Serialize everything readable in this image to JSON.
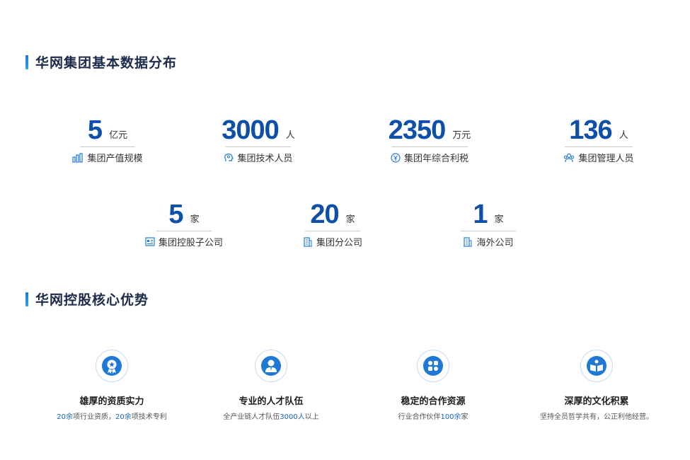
{
  "section1": {
    "title": "华网集团基本数据分布"
  },
  "stats_row1": [
    {
      "value": "5",
      "unit": "亿元",
      "label": "集团产值规模",
      "icon": "building-chart-icon"
    },
    {
      "value": "3000",
      "unit": "人",
      "label": "集团技术人员",
      "icon": "head-brain-icon"
    },
    {
      "value": "2350",
      "unit": "万元",
      "label": "集团年综合利税",
      "icon": "coin-circle-icon"
    },
    {
      "value": "136",
      "unit": "人",
      "label": "集团管理人员",
      "icon": "people-group-icon"
    }
  ],
  "stats_row2": [
    {
      "value": "5",
      "unit": "家",
      "label": "集团控股子公司",
      "icon": "id-card-icon"
    },
    {
      "value": "20",
      "unit": "家",
      "label": "集团分公司",
      "icon": "office-building-icon"
    },
    {
      "value": "1",
      "unit": "家",
      "label": "海外公司",
      "icon": "office-building-icon"
    }
  ],
  "section2": {
    "title": "华网控股核心优势"
  },
  "advantages": [
    {
      "title": "雄厚的资质实力",
      "desc_parts": [
        {
          "t": "20余",
          "hl": true
        },
        {
          "t": "项行业资质，",
          "hl": false
        },
        {
          "t": "20余",
          "hl": true
        },
        {
          "t": "项技术专利",
          "hl": false
        }
      ],
      "icon": "award-medal-icon"
    },
    {
      "title": "专业的人才队伍",
      "desc_parts": [
        {
          "t": "全产业链人才队伍",
          "hl": false
        },
        {
          "t": "3000人",
          "hl": true
        },
        {
          "t": "以上",
          "hl": false
        }
      ],
      "icon": "person-suit-icon"
    },
    {
      "title": "稳定的合作资源",
      "desc_parts": [
        {
          "t": "行业合作伙伴",
          "hl": false
        },
        {
          "t": "100余",
          "hl": true
        },
        {
          "t": "家",
          "hl": false
        }
      ],
      "icon": "four-leaf-grid-icon"
    },
    {
      "title": "深厚的文化积累",
      "desc_parts": [
        {
          "t": "坚持全员哲学共有，公正利他经营。",
          "hl": false
        }
      ],
      "icon": "open-book-icon"
    }
  ],
  "colors": {
    "accent": "#0d4fa9",
    "title": "#1c2b4a",
    "highlight": "#1565c0",
    "icon": "#1e7ad8"
  }
}
